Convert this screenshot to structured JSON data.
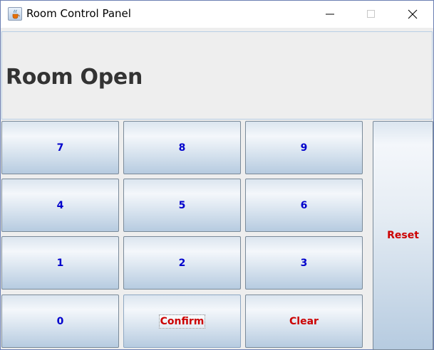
{
  "window": {
    "title": "Room Control Panel"
  },
  "status": {
    "text": "Room Open"
  },
  "keypad": {
    "keys": [
      {
        "label": "7"
      },
      {
        "label": "8"
      },
      {
        "label": "9"
      },
      {
        "label": "4"
      },
      {
        "label": "5"
      },
      {
        "label": "6"
      },
      {
        "label": "1"
      },
      {
        "label": "2"
      },
      {
        "label": "3"
      },
      {
        "label": "0"
      },
      {
        "label": "Confirm"
      },
      {
        "label": "Clear"
      }
    ],
    "reset_label": "Reset"
  },
  "colors": {
    "digit_text": "#0000cc",
    "action_text": "#cc0000",
    "status_text": "#333333"
  },
  "icons": {
    "app": "java-cup-icon",
    "minimize": "minimize-icon",
    "maximize": "maximize-icon",
    "close": "close-icon"
  }
}
